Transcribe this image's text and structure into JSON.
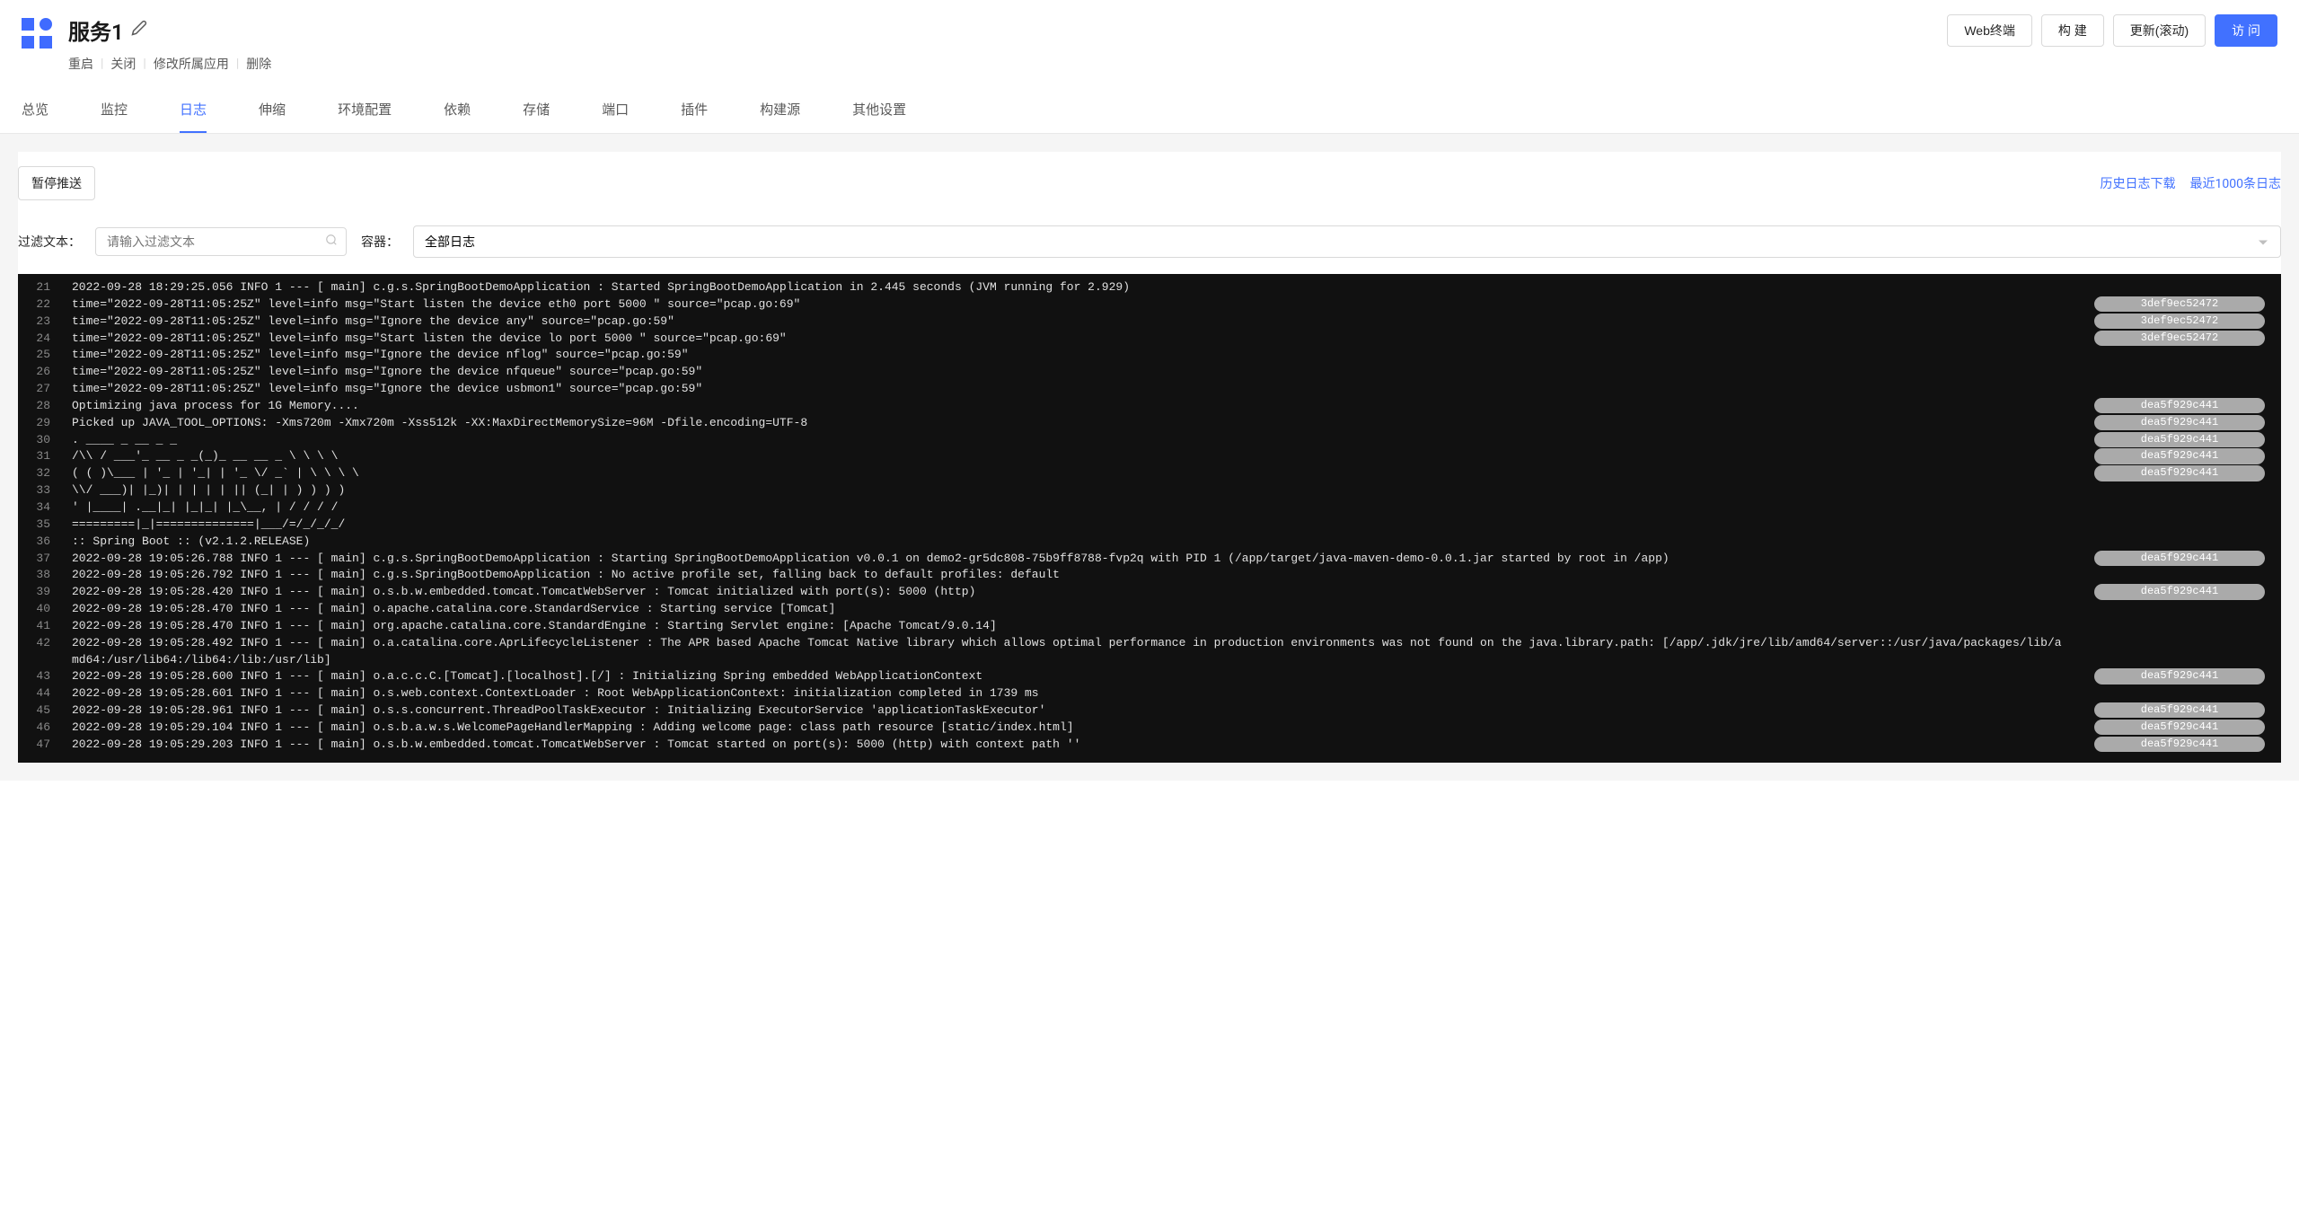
{
  "header": {
    "title": "服务1"
  },
  "header_actions": [
    "重启",
    "关闭",
    "修改所属应用",
    "删除"
  ],
  "header_buttons": {
    "web_terminal": "Web终端",
    "build": "构 建",
    "update_scroll": "更新(滚动)",
    "visit": "访 问"
  },
  "tabs": [
    "总览",
    "监控",
    "日志",
    "伸缩",
    "环境配置",
    "依赖",
    "存储",
    "端口",
    "插件",
    "构建源",
    "其他设置"
  ],
  "active_tab_index": 2,
  "toolbar": {
    "pause_push": "暂停推送",
    "history_download": "历史日志下载",
    "recent_1000": "最近1000条日志"
  },
  "filter": {
    "text_label": "过滤文本：",
    "text_placeholder": "请输入过滤文本",
    "container_label": "容器：",
    "container_value": "全部日志"
  },
  "log_lines": [
    {
      "ln": 21,
      "text": "2022-09-28 18:29:25.056 INFO 1 --- [ main] c.g.s.SpringBootDemoApplication : Started SpringBootDemoApplication in 2.445 seconds (JVM running for 2.929)",
      "tag": ""
    },
    {
      "ln": 22,
      "text": "time=\"2022-09-28T11:05:25Z\" level=info msg=\"Start listen the device eth0 port 5000 \" source=\"pcap.go:69\"",
      "tag": "3def9ec52472"
    },
    {
      "ln": 23,
      "text": "time=\"2022-09-28T11:05:25Z\" level=info msg=\"Ignore the device any\" source=\"pcap.go:59\"",
      "tag": "3def9ec52472"
    },
    {
      "ln": 24,
      "text": "time=\"2022-09-28T11:05:25Z\" level=info msg=\"Start listen the device lo port 5000 \" source=\"pcap.go:69\"",
      "tag": "3def9ec52472"
    },
    {
      "ln": 25,
      "text": "time=\"2022-09-28T11:05:25Z\" level=info msg=\"Ignore the device nflog\" source=\"pcap.go:59\"",
      "tag": ""
    },
    {
      "ln": 26,
      "text": "time=\"2022-09-28T11:05:25Z\" level=info msg=\"Ignore the device nfqueue\" source=\"pcap.go:59\"",
      "tag": ""
    },
    {
      "ln": 27,
      "text": "time=\"2022-09-28T11:05:25Z\" level=info msg=\"Ignore the device usbmon1\" source=\"pcap.go:59\"",
      "tag": ""
    },
    {
      "ln": 28,
      "text": "Optimizing java process for 1G Memory....",
      "tag": "dea5f929c441"
    },
    {
      "ln": 29,
      "text": "Picked up JAVA_TOOL_OPTIONS: -Xms720m -Xmx720m -Xss512k -XX:MaxDirectMemorySize=96M -Dfile.encoding=UTF-8",
      "tag": "dea5f929c441"
    },
    {
      "ln": 30,
      "text": ". ____ _ __ _ _",
      "tag": "dea5f929c441"
    },
    {
      "ln": 31,
      "text": "/\\\\ / ___'_ __ _ _(_)_ __ __ _ \\ \\ \\ \\",
      "tag": "dea5f929c441"
    },
    {
      "ln": 32,
      "text": "( ( )\\___ | '_ | '_| | '_ \\/ _` | \\ \\ \\ \\",
      "tag": "dea5f929c441"
    },
    {
      "ln": 33,
      "text": "\\\\/ ___)| |_)| | | | | || (_| | ) ) ) )",
      "tag": ""
    },
    {
      "ln": 34,
      "text": "' |____| .__|_| |_|_| |_\\__, | / / / /",
      "tag": ""
    },
    {
      "ln": 35,
      "text": "=========|_|==============|___/=/_/_/_/",
      "tag": ""
    },
    {
      "ln": 36,
      "text": ":: Spring Boot :: (v2.1.2.RELEASE)",
      "tag": ""
    },
    {
      "ln": 37,
      "text": "2022-09-28 19:05:26.788 INFO 1 --- [ main] c.g.s.SpringBootDemoApplication : Starting SpringBootDemoApplication v0.0.1 on demo2-gr5dc808-75b9ff8788-fvp2q with PID 1 (/app/target/java-maven-demo-0.0.1.jar started by root in /app)",
      "tag": "dea5f929c441"
    },
    {
      "ln": 38,
      "text": "2022-09-28 19:05:26.792 INFO 1 --- [ main] c.g.s.SpringBootDemoApplication : No active profile set, falling back to default profiles: default",
      "tag": ""
    },
    {
      "ln": 39,
      "text": "2022-09-28 19:05:28.420 INFO 1 --- [ main] o.s.b.w.embedded.tomcat.TomcatWebServer : Tomcat initialized with port(s): 5000 (http)",
      "tag": "dea5f929c441"
    },
    {
      "ln": 40,
      "text": "2022-09-28 19:05:28.470 INFO 1 --- [ main] o.apache.catalina.core.StandardService : Starting service [Tomcat]",
      "tag": ""
    },
    {
      "ln": 41,
      "text": "2022-09-28 19:05:28.470 INFO 1 --- [ main] org.apache.catalina.core.StandardEngine : Starting Servlet engine: [Apache Tomcat/9.0.14]",
      "tag": ""
    },
    {
      "ln": 42,
      "text": "2022-09-28 19:05:28.492 INFO 1 --- [ main] o.a.catalina.core.AprLifecycleListener : The APR based Apache Tomcat Native library which allows optimal performance in production environments was not found on the java.library.path: [/app/.jdk/jre/lib/amd64/server::/usr/java/packages/lib/amd64:/usr/lib64:/lib64:/lib:/usr/lib]",
      "tag": ""
    },
    {
      "ln": 43,
      "text": "2022-09-28 19:05:28.600 INFO 1 --- [ main] o.a.c.c.C.[Tomcat].[localhost].[/] : Initializing Spring embedded WebApplicationContext",
      "tag": "dea5f929c441"
    },
    {
      "ln": 44,
      "text": "2022-09-28 19:05:28.601 INFO 1 --- [ main] o.s.web.context.ContextLoader : Root WebApplicationContext: initialization completed in 1739 ms",
      "tag": ""
    },
    {
      "ln": 45,
      "text": "2022-09-28 19:05:28.961 INFO 1 --- [ main] o.s.s.concurrent.ThreadPoolTaskExecutor : Initializing ExecutorService 'applicationTaskExecutor'",
      "tag": "dea5f929c441"
    },
    {
      "ln": 46,
      "text": "2022-09-28 19:05:29.104 INFO 1 --- [ main] o.s.b.a.w.s.WelcomePageHandlerMapping : Adding welcome page: class path resource [static/index.html]",
      "tag": "dea5f929c441"
    },
    {
      "ln": 47,
      "text": "2022-09-28 19:05:29.203 INFO 1 --- [ main] o.s.b.w.embedded.tomcat.TomcatWebServer : Tomcat started on port(s): 5000 (http) with context path ''",
      "tag": "dea5f929c441"
    }
  ]
}
